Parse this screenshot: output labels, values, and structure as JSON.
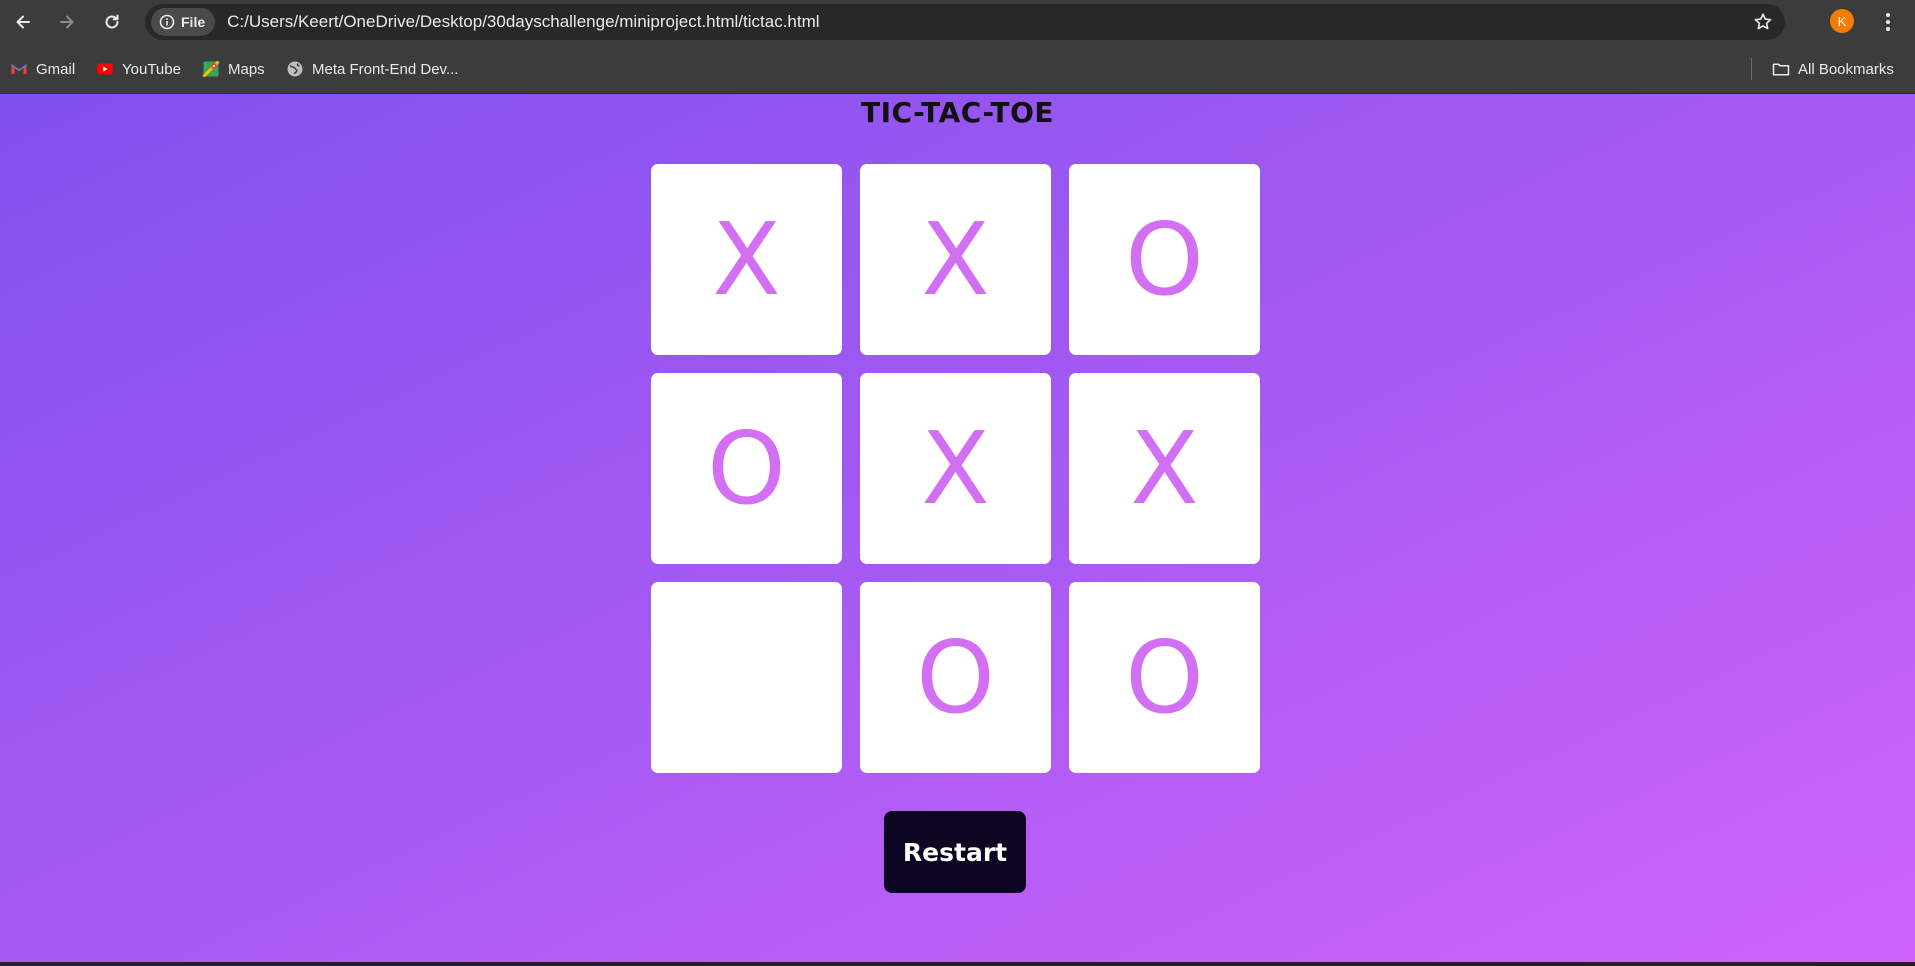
{
  "browser": {
    "site_chip_label": "File",
    "url": "C:/Users/Keert/OneDrive/Desktop/30dayschallenge/miniproject.html/tictac.html",
    "profile_initial": "K",
    "bookmarks": [
      {
        "label": "Gmail",
        "icon": "gmail-icon"
      },
      {
        "label": "YouTube",
        "icon": "youtube-icon"
      },
      {
        "label": "Maps",
        "icon": "maps-icon"
      },
      {
        "label": "Meta Front-End Dev...",
        "icon": "globe-icon"
      }
    ],
    "all_bookmarks_label": "All Bookmarks"
  },
  "game": {
    "title": "TIC-TAC-TOE",
    "cells": [
      "X",
      "X",
      "O",
      "O",
      "X",
      "X",
      "",
      "O",
      "O"
    ],
    "restart_label": "Restart"
  },
  "colors": {
    "gradient_start": "#8150ee",
    "gradient_end": "#cf63fb",
    "mark_color": "#d36ff3",
    "restart_bg": "#0d0623"
  }
}
